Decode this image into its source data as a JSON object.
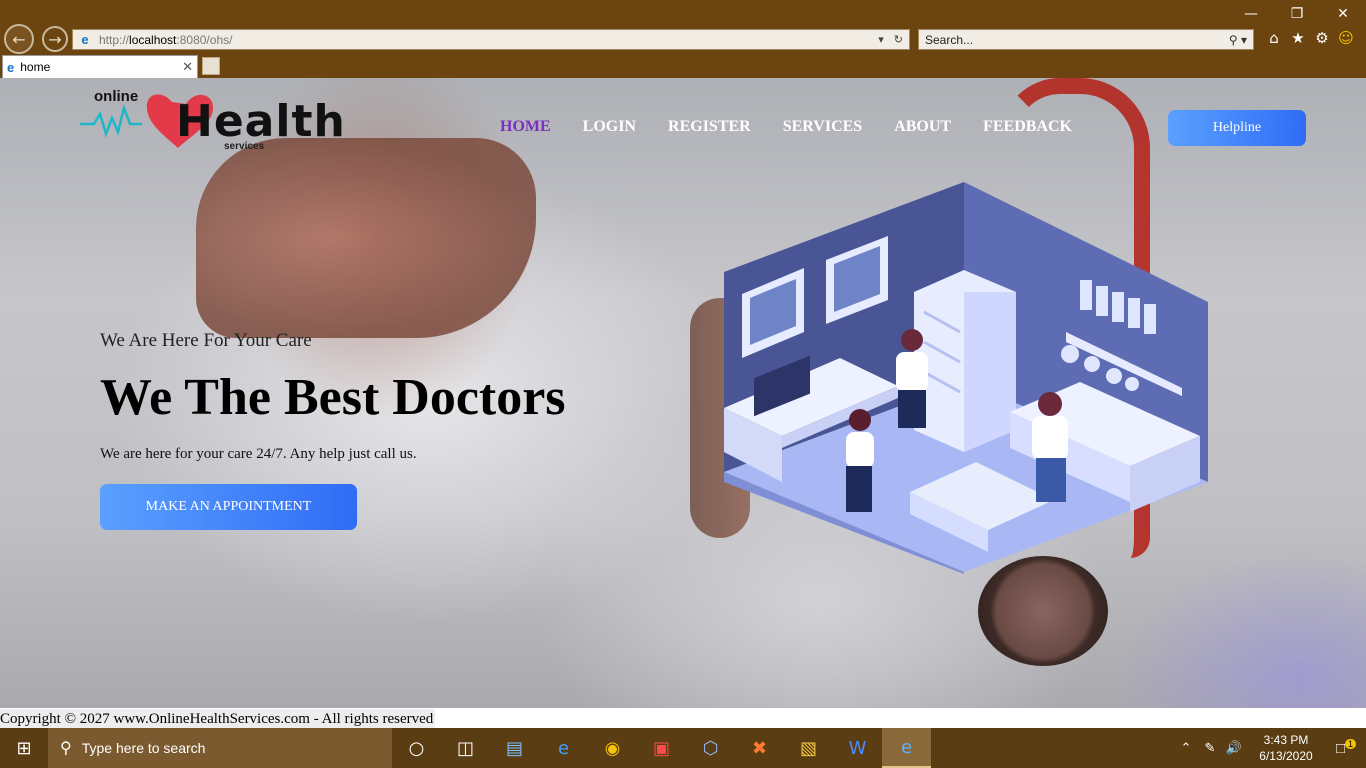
{
  "browser": {
    "url_scheme": "http://",
    "url_host": "localhost",
    "url_path": ":8080/ohs/",
    "search_placeholder": "Search...",
    "tab_title": "home"
  },
  "site": {
    "logo_online": "online",
    "logo_health": "Health",
    "logo_services": "services",
    "menu": [
      "HOME",
      "LOGIN",
      "REGISTER",
      "SERVICES",
      "ABOUT",
      "FEEDBACK"
    ],
    "active_menu": "HOME",
    "helpline_label": "Helpline",
    "tagline": "We Are Here For Your Care",
    "headline": "We The Best Doctors",
    "subtext": "We are here for your care 24/7. Any help just call us.",
    "appointment_label": "MAKE AN APPOINTMENT",
    "footer": "Copyright © 2027 www.OnlineHealthServices.com - All rights reserved"
  },
  "taskbar": {
    "search_placeholder": "Type here to search",
    "time": "3:43 PM",
    "date": "6/13/2020",
    "notification_count": "1"
  },
  "colors": {
    "accent_blue": "#3f7ef8",
    "active_menu": "#7b2fbe",
    "chrome": "#6b4410",
    "taskbar": "#5a3d12"
  }
}
